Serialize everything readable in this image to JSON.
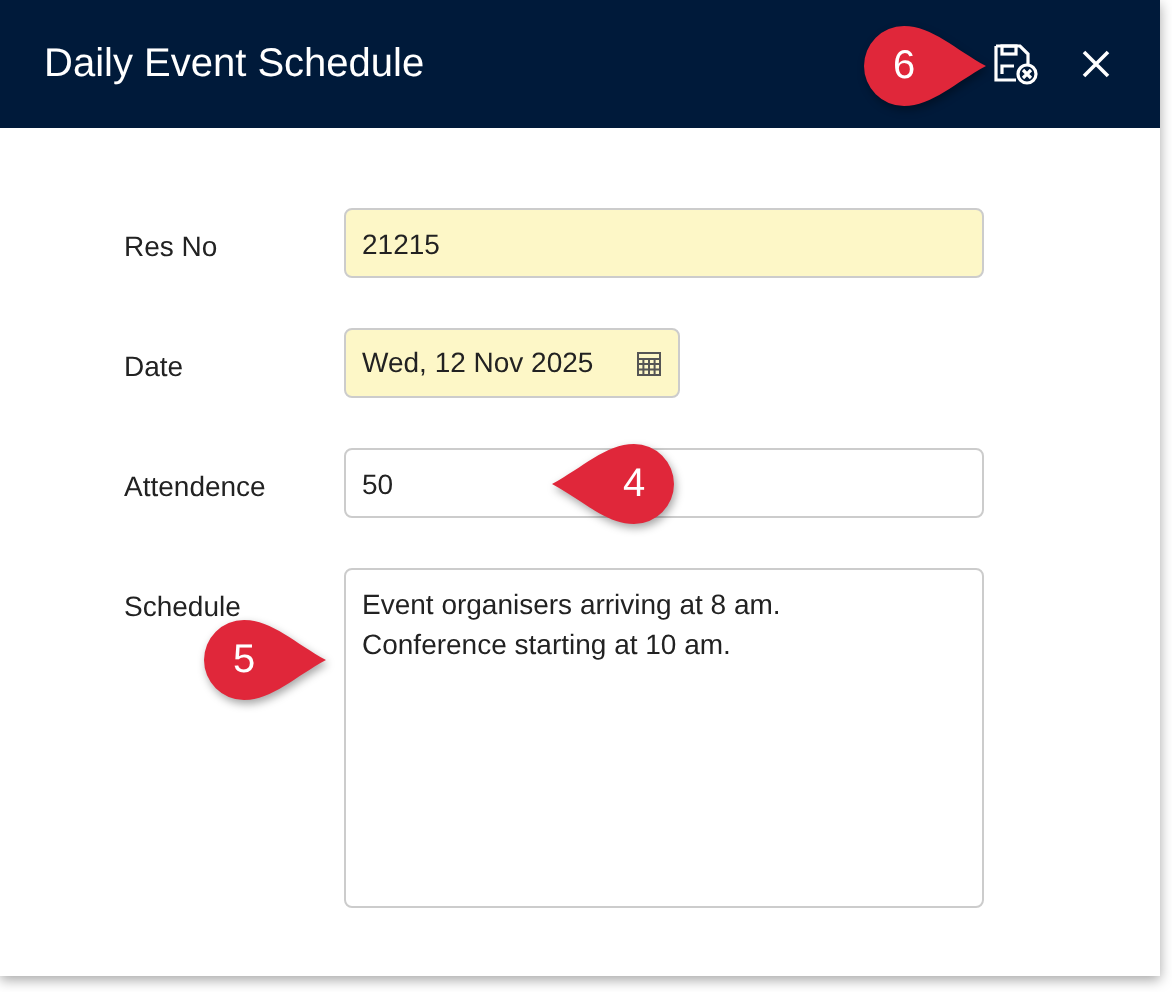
{
  "window": {
    "title": "Daily Event Schedule"
  },
  "header_buttons": [
    {
      "kind": "discard"
    },
    {
      "kind": "close"
    }
  ],
  "fields": [
    {
      "kind": "text",
      "label": "Res No",
      "value": "21215",
      "highlighted": true
    },
    {
      "kind": "date",
      "label": "Date",
      "value": "Wed, 12 Nov 2025",
      "highlighted": true
    },
    {
      "kind": "text",
      "label": "Attendence",
      "value": "50",
      "highlighted": false
    },
    {
      "kind": "textarea",
      "label": "Schedule",
      "value": "Event organisers arriving at 8 am.\nConference starting at 10 am.",
      "highlighted": false
    }
  ],
  "callouts": [
    {
      "number": "6",
      "points_left": false
    },
    {
      "number": "4",
      "points_left": true
    },
    {
      "number": "5",
      "points_left": false
    }
  ]
}
